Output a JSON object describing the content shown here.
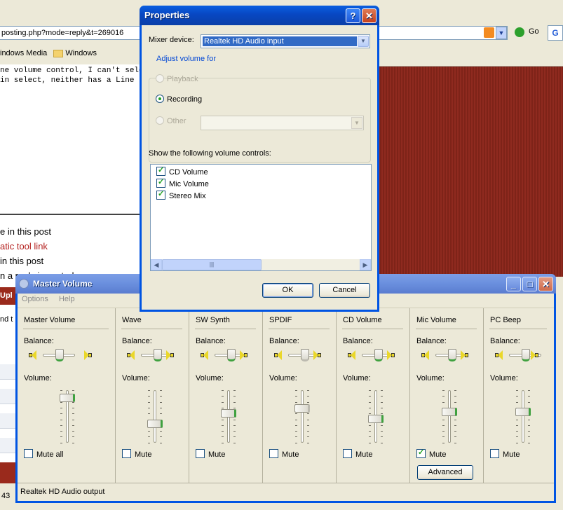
{
  "browser": {
    "address": "posting.php?mode=reply&t=269016",
    "go_label": "Go",
    "links": [
      "indows Media",
      "Windows"
    ],
    "editor_lines": [
      "ne volume control, I can't select the",
      "in select, neither has a Line In sect"
    ],
    "options": [
      {
        "text": "e in this post",
        "red": false
      },
      {
        "text": "atic tool link",
        "red": true
      },
      {
        "text": "in this post",
        "red": false
      },
      {
        "text": "n a reply is posted",
        "red": false
      }
    ],
    "side_label": "Upl",
    "side_text": "nd t",
    "status_text": "43"
  },
  "properties": {
    "title": "Properties",
    "mixer_label": "Mixer device:",
    "mixer_value": "Realtek HD Audio input",
    "group_label": "Adjust volume for",
    "radio_playback": "Playback",
    "radio_recording": "Recording",
    "radio_other": "Other",
    "selected_radio": "Recording",
    "show_label": "Show the following volume controls:",
    "controls": [
      {
        "label": "CD Volume",
        "checked": true
      },
      {
        "label": "Mic Volume",
        "checked": true
      },
      {
        "label": "Stereo Mix",
        "checked": true
      }
    ],
    "ok_label": "OK",
    "cancel_label": "Cancel"
  },
  "master": {
    "title": "Master Volume",
    "menu": [
      "Options",
      "Help"
    ],
    "balance_label": "Balance:",
    "volume_label": "Volume:",
    "mute_label": "Mute",
    "mute_all_label": "Mute all",
    "advanced_label": "Advanced",
    "status": "Realtek HD Audio output",
    "channels": [
      {
        "name": "Master Volume",
        "volume": 0.92,
        "muted": false,
        "active": true
      },
      {
        "name": "Wave",
        "volume": 0.38,
        "muted": false,
        "active": true
      },
      {
        "name": "SW Synth",
        "volume": 0.6,
        "muted": false,
        "active": true
      },
      {
        "name": "SPDIF",
        "volume": 0.7,
        "muted": false,
        "active": false
      },
      {
        "name": "CD Volume",
        "volume": 0.48,
        "muted": false,
        "active": true
      },
      {
        "name": "Mic Volume",
        "volume": 0.63,
        "muted": true,
        "active": true
      },
      {
        "name": "PC Beep",
        "volume": 0.63,
        "muted": false,
        "active": true
      }
    ]
  },
  "colors": {
    "title_active": "#0a54e0",
    "title_inactive": "#7c9ee6",
    "slider_accent": "#3fa13f",
    "selection": "#316ac5",
    "forum_red": "#8f2a1f"
  }
}
